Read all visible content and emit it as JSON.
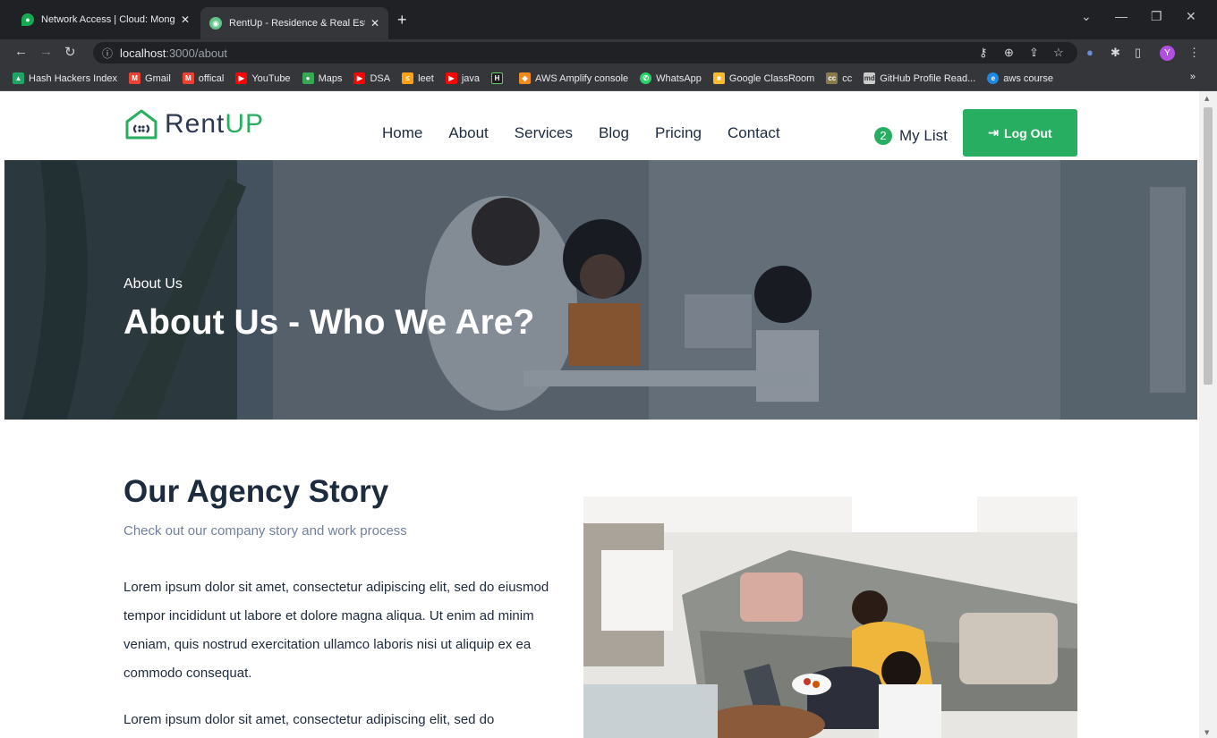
{
  "browser": {
    "tabs": [
      {
        "title": "Network Access | Cloud: MongoD",
        "active": false
      },
      {
        "title": "RentUp - Residence & Real Estate",
        "active": true
      }
    ],
    "url_host": "localhost",
    "url_path": ":3000/about",
    "bookmarks": [
      {
        "label": "Hash Hackers Index",
        "icon": "drive-icon",
        "color": "#1fa463"
      },
      {
        "label": "Gmail",
        "icon": "gmail-icon",
        "color": "#ea4335"
      },
      {
        "label": "offical",
        "icon": "gmail-icon",
        "color": "#ea4335"
      },
      {
        "label": "YouTube",
        "icon": "youtube-icon",
        "color": "#ff0000"
      },
      {
        "label": "Maps",
        "icon": "maps-icon",
        "color": "#34a853"
      },
      {
        "label": "DSA",
        "icon": "youtube-icon",
        "color": "#ff0000"
      },
      {
        "label": "leet",
        "icon": "leetcode-icon",
        "color": "#ffa116"
      },
      {
        "label": "java",
        "icon": "youtube-icon",
        "color": "#ff0000"
      },
      {
        "label": "",
        "icon": "hackerrank-icon",
        "color": "#1b1b1b"
      },
      {
        "label": "AWS Amplify console",
        "icon": "aws-icon",
        "color": "#f28b1c"
      },
      {
        "label": "WhatsApp",
        "icon": "whatsapp-icon",
        "color": "#25d366"
      },
      {
        "label": "Google ClassRoom",
        "icon": "classroom-icon",
        "color": "#f9bb2d"
      },
      {
        "label": "cc",
        "icon": "cc-icon",
        "color": "#8a7a4a"
      },
      {
        "label": "GitHub Profile Read...",
        "icon": "github-readme-icon",
        "color": "#cccccc"
      },
      {
        "label": "aws course",
        "icon": "edge-icon",
        "color": "#1e88e5"
      }
    ],
    "profile_initial": "Y"
  },
  "header": {
    "logo_rent": "Rent",
    "logo_up": "UP",
    "nav": [
      "Home",
      "About",
      "Services",
      "Blog",
      "Pricing",
      "Contact"
    ],
    "mylist_count": "2",
    "mylist_label": "My List",
    "logout_label": "Log Out"
  },
  "hero": {
    "subtitle": "About Us",
    "title": "About Us - Who We Are?"
  },
  "story": {
    "title": "Our Agency Story",
    "subtitle": "Check out our company story and work process",
    "paragraphs": [
      "Lorem ipsum dolor sit amet, consectetur adipiscing elit, sed do eiusmod tempor incididunt ut labore et dolore magna aliqua. Ut enim ad minim veniam, quis nostrud exercitation ullamco laboris nisi ut aliquip ex ea commodo consequat.",
      "Lorem ipsum dolor sit amet, consectetur adipiscing elit, sed do"
    ]
  },
  "colors": {
    "accent": "#27ae60",
    "heading": "#1d2b3f",
    "muted": "#72809d"
  }
}
